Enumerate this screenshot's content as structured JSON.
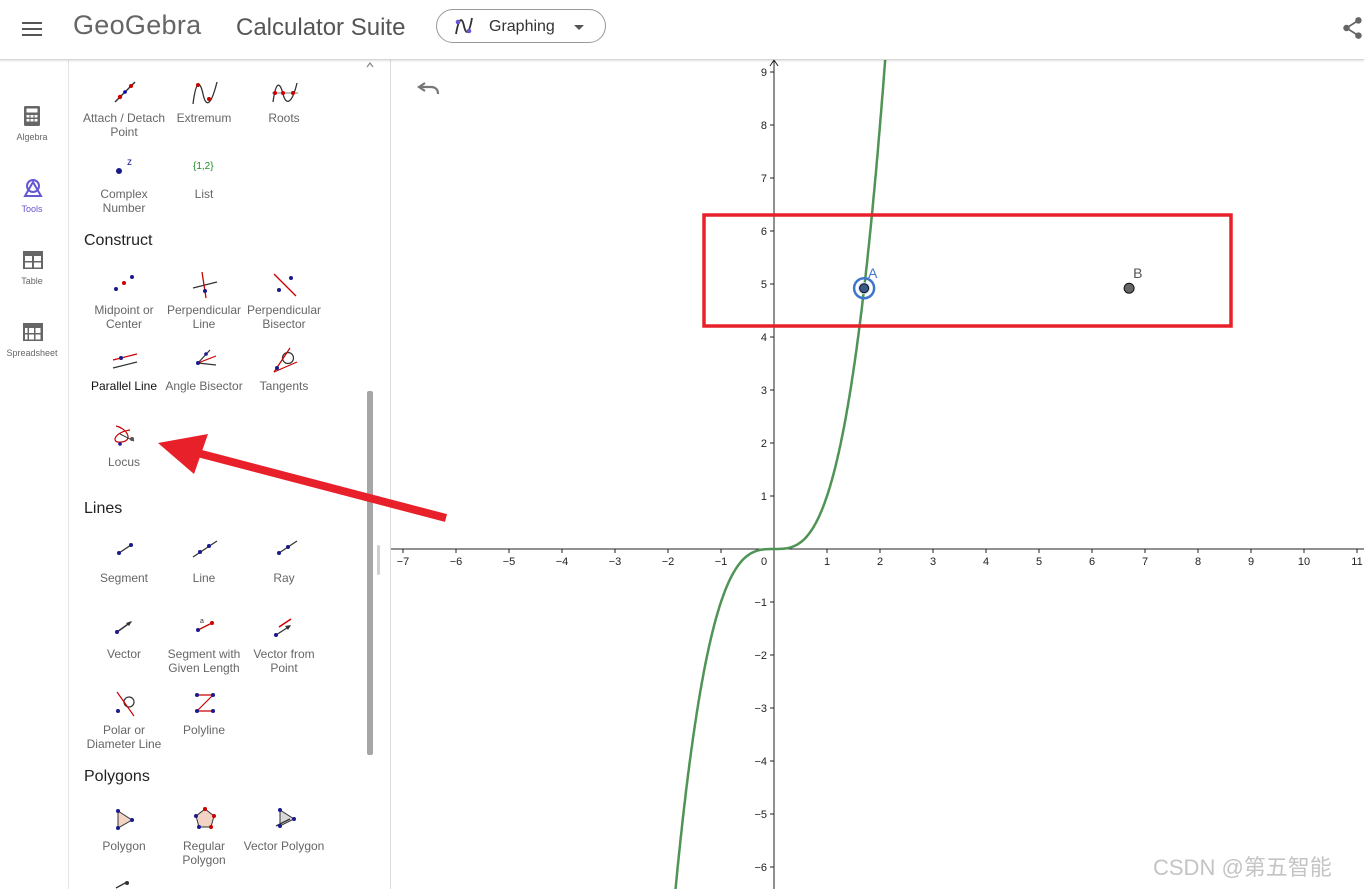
{
  "header": {
    "brand": "GeoGebra",
    "suite_title": "Calculator Suite",
    "app_selector": {
      "label": "Graphing"
    }
  },
  "rail": [
    {
      "label": "Algebra"
    },
    {
      "label": "Tools",
      "active": true
    },
    {
      "label": "Table"
    },
    {
      "label": "Spreadsheet"
    }
  ],
  "tools": {
    "top": [
      {
        "label": "Attach / Detach Point"
      },
      {
        "label": "Extremum"
      },
      {
        "label": "Roots"
      },
      {
        "label": "Complex Number"
      },
      {
        "label": "List",
        "icon_text": "{1,2}"
      }
    ],
    "construct": {
      "title": "Construct",
      "items": [
        {
          "label": "Midpoint or Center"
        },
        {
          "label": "Perpendicular Line"
        },
        {
          "label": "Perpendicular Bisector"
        },
        {
          "label": "Parallel Line",
          "selected": true
        },
        {
          "label": "Angle Bisector"
        },
        {
          "label": "Tangents"
        },
        {
          "label": "Locus"
        }
      ]
    },
    "lines": {
      "title": "Lines",
      "items": [
        {
          "label": "Segment"
        },
        {
          "label": "Line"
        },
        {
          "label": "Ray"
        },
        {
          "label": "Vector"
        },
        {
          "label": "Segment with Given Length",
          "icon_text": "a"
        },
        {
          "label": "Vector from Point"
        },
        {
          "label": "Polar or Diameter Line"
        },
        {
          "label": "Polyline"
        }
      ]
    },
    "polygons": {
      "title": "Polygons",
      "items": [
        {
          "label": "Polygon"
        },
        {
          "label": "Regular Polygon"
        },
        {
          "label": "Vector Polygon"
        }
      ]
    }
  },
  "graph": {
    "x_range": [
      -7.4,
      11.1
    ],
    "y_range": [
      -6.4,
      9.3
    ],
    "x_ticks": [
      "-7",
      "-6",
      "-5",
      "-4",
      "-3",
      "-2",
      "-1",
      "0",
      "1",
      "2",
      "3",
      "4",
      "5",
      "6",
      "7",
      "8",
      "9",
      "10",
      "11"
    ],
    "y_ticks": [
      "9",
      "8",
      "7",
      "6",
      "5",
      "4",
      "3",
      "2",
      "1",
      "-1",
      "-2",
      "-3",
      "-4",
      "-5",
      "-6"
    ],
    "function": "y = x^3",
    "curve_color": "#4f9455",
    "points": [
      {
        "name": "A",
        "x": 1.7,
        "y": 4.92,
        "selected": true,
        "color": "#3e76c9"
      },
      {
        "name": "B",
        "x": 6.7,
        "y": 4.92,
        "selected": false,
        "color": "#555555"
      }
    ],
    "annotation_color": "#e8202a"
  },
  "watermark": "CSDN @第五智能"
}
